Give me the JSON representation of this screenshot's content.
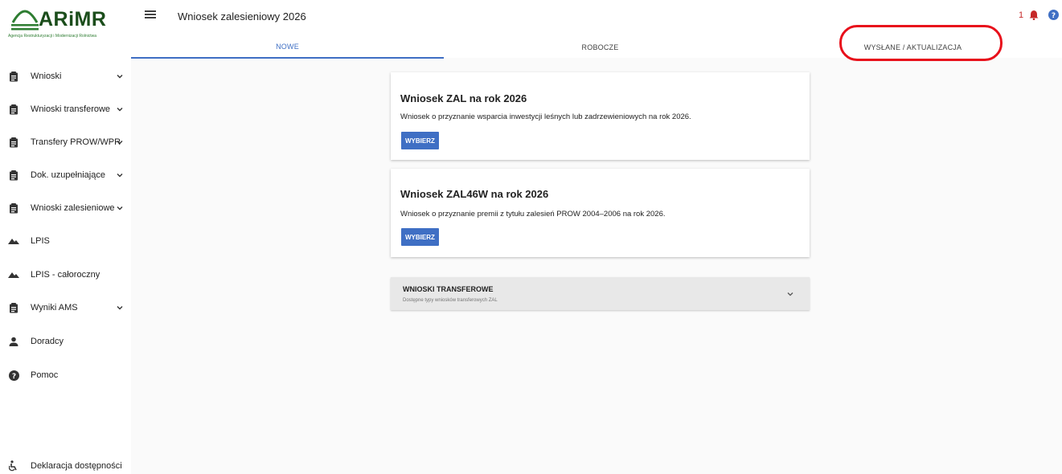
{
  "logo": {
    "name": "ARiMR",
    "subtitle": "Agencja Restrukturyzacji i Modernizacji Rolnictwa"
  },
  "header": {
    "title": "Wniosek zalesieniowy 2026",
    "notification_count": "1"
  },
  "tabs": [
    {
      "label": "NOWE",
      "active": true
    },
    {
      "label": "ROBOCZE",
      "active": false
    },
    {
      "label": "WYSŁANE / AKTUALIZACJA",
      "active": false
    }
  ],
  "sidebar": {
    "items": [
      {
        "label": "Wnioski",
        "icon": "clipboard-icon",
        "expandable": true
      },
      {
        "label": "Wnioski transferowe",
        "icon": "clipboard-icon",
        "expandable": true
      },
      {
        "label": "Transfery PROW/WPR",
        "icon": "clipboard-icon",
        "expandable": true
      },
      {
        "label": "Dok. uzupełniające",
        "icon": "clipboard-icon",
        "expandable": true
      },
      {
        "label": "Wnioski zalesieniowe",
        "icon": "clipboard-icon",
        "expandable": true
      },
      {
        "label": "LPIS",
        "icon": "terrain-icon",
        "expandable": false
      },
      {
        "label": "LPIS - całoroczny",
        "icon": "terrain-icon",
        "expandable": false
      },
      {
        "label": "Wyniki AMS",
        "icon": "clipboard-icon",
        "expandable": true
      },
      {
        "label": "Doradcy",
        "icon": "person-icon",
        "expandable": false
      },
      {
        "label": "Pomoc",
        "icon": "help-icon",
        "expandable": false
      }
    ],
    "footer": {
      "label": "Deklaracja dostępności",
      "icon": "accessibility-icon"
    }
  },
  "cards": [
    {
      "title": "Wniosek ZAL na rok 2026",
      "description": "Wniosek o przyznanie wsparcia inwestycji leśnych lub zadrzewieniowych na rok 2026.",
      "button": "WYBIERZ"
    },
    {
      "title": "Wniosek ZAL46W na rok 2026",
      "description": "Wniosek o przyznanie premii z tytułu zalesień PROW 2004–2006 na rok 2026.",
      "button": "WYBIERZ"
    }
  ],
  "accordion": {
    "title": "WNIOSKI TRANSFEROWE",
    "subtitle": "Dostępne typy wniosków transferowych ZAL"
  },
  "colors": {
    "accent": "#3f6fc4",
    "highlight": "#e8101b",
    "notification": "#c62828",
    "brand": "#1b4d1b"
  }
}
